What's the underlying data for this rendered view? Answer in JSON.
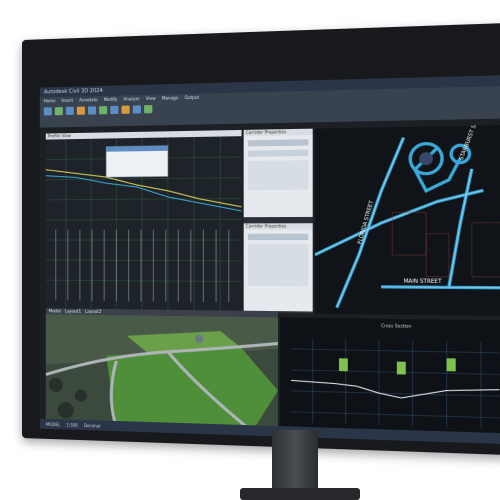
{
  "app": {
    "title_bar_text": "Autodesk Civil 3D 2024",
    "ribbon_tabs": [
      "Home",
      "Insert",
      "Annotate",
      "Modify",
      "Analyze",
      "View",
      "Manage",
      "Output"
    ]
  },
  "panes": {
    "profile_title": "Profile View",
    "dialog1_title": "Corridor Properties",
    "dialog2_title": "Corridor Properties",
    "plan_streets": {
      "street_a": "STARBURST STREET",
      "street_b": "MAIN STREET",
      "street_c": "FLORIDA STREET"
    },
    "xsec_title": "Cross Section"
  },
  "tabs_strip": [
    "Model",
    "Layout1",
    "Layout2"
  ],
  "status": [
    "MODEL",
    "1:500",
    "Decimal"
  ],
  "colors": {
    "grid_green": "#3c8a4a",
    "accent_blue": "#5e8dc4",
    "road_cyan": "#3aa8d8",
    "field_green": "#4f8f3a"
  }
}
